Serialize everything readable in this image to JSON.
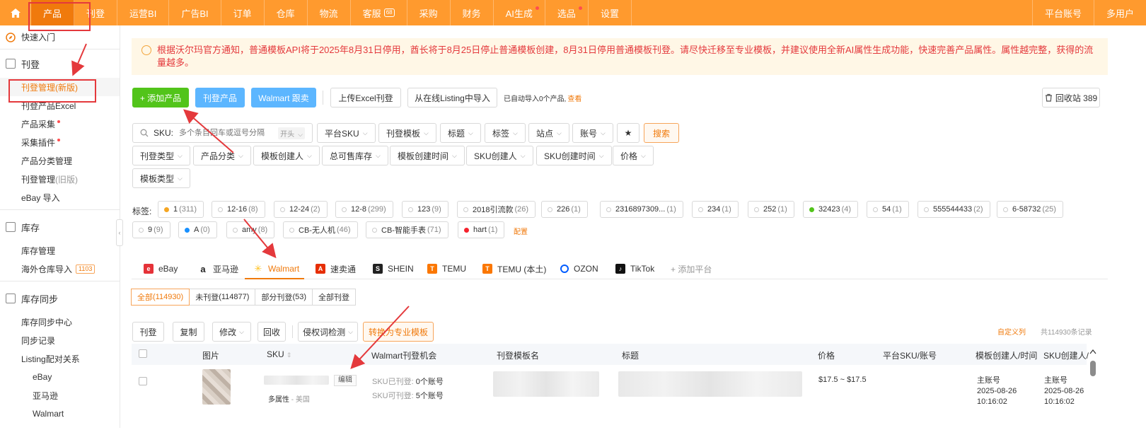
{
  "topnav": {
    "items": [
      {
        "label": "产品",
        "active": true
      },
      {
        "label": "刊登"
      },
      {
        "label": "运营BI"
      },
      {
        "label": "广告BI"
      },
      {
        "label": "订单"
      },
      {
        "label": "仓库"
      },
      {
        "label": "物流"
      },
      {
        "label": "客服",
        "badge": "68"
      },
      {
        "label": "采购"
      },
      {
        "label": "财务"
      },
      {
        "label": "AI生成",
        "dot": true
      },
      {
        "label": "选品",
        "dot": true
      },
      {
        "label": "设置"
      }
    ],
    "right": [
      "平台账号",
      "多用户"
    ]
  },
  "sidebar": {
    "quick": "快速入门",
    "sections": [
      {
        "title": "刊登",
        "items": [
          {
            "label": "刊登管理",
            "suffix": "(新版)",
            "active": true
          },
          {
            "label": "刊登产品Excel"
          },
          {
            "label": "产品采集",
            "dot": true
          },
          {
            "label": "采集插件",
            "dot": true
          },
          {
            "label": "产品分类管理"
          },
          {
            "label": "刊登管理",
            "suffix": "(旧版)"
          },
          {
            "label": "eBay 导入"
          }
        ]
      },
      {
        "title": "库存",
        "items": [
          {
            "label": "库存管理"
          },
          {
            "label": "海外仓库导入",
            "badge": "1103"
          }
        ]
      },
      {
        "title": "库存同步",
        "items": [
          {
            "label": "库存同步中心"
          },
          {
            "label": "同步记录"
          },
          {
            "label": "Listing配对关系"
          },
          {
            "label": "eBay",
            "sub": true
          },
          {
            "label": "亚马逊",
            "sub": true
          },
          {
            "label": "Walmart",
            "sub": true
          }
        ]
      }
    ]
  },
  "notice": {
    "text": "根据沃尔玛官方通知，普通模板API将于2025年8月31日停用，酋长将于8月25日停止普通模板创建，8月31日停用普通模板刊登。请尽快迁移至专业模板，并建议使用全新AI属性生成功能，快速完善产品属性。属性越完整，获得的流量越多。"
  },
  "toolbar": {
    "add": "+ 添加产品",
    "publish": "刊登产品",
    "follow": "Walmart 跟卖",
    "upload": "上传Excel刊登",
    "import": "从在线Listing中导入",
    "import_status": "已自动导入0个产品,",
    "view": "查看",
    "recycle": "回收站 389"
  },
  "filters": {
    "sku_label": "SKU:",
    "sku_placeholder": "多个条目回车或逗号分隔",
    "sku_mode": "开头",
    "row1": [
      "平台SKU",
      "刊登模板",
      "标题",
      "标签",
      "站点",
      "账号"
    ],
    "star": "★",
    "search": "搜索",
    "row2": [
      "刊登类型",
      "产品分类",
      "模板创建人",
      "总可售库存",
      "模板创建时间",
      "SKU创建人",
      "SKU创建时间",
      "价格"
    ],
    "row3": [
      "模板类型"
    ]
  },
  "tags": {
    "label": "标签:",
    "items": [
      {
        "name": "1",
        "count": "(311)",
        "color": "#f5a623"
      },
      {
        "name": "12-16",
        "count": "(8)"
      },
      {
        "name": "12-24",
        "count": "(2)"
      },
      {
        "name": "12-8",
        "count": "(299)"
      },
      {
        "name": "123",
        "count": "(9)"
      },
      {
        "name": "2018引流款",
        "count": "(26)"
      },
      {
        "name": "226",
        "count": "(1)"
      },
      {
        "name": "2316897309...",
        "count": "(1)"
      },
      {
        "name": "234",
        "count": "(1)"
      },
      {
        "name": "252",
        "count": "(1)"
      },
      {
        "name": "32423",
        "count": "(4)",
        "color": "#52c41a"
      },
      {
        "name": "54",
        "count": "(1)"
      },
      {
        "name": "555544433",
        "count": "(2)"
      },
      {
        "name": "6-58732",
        "count": "(25)"
      },
      {
        "name": "9",
        "count": "(9)"
      },
      {
        "name": "A",
        "count": "(0)",
        "color": "#1890ff"
      },
      {
        "name": "amy",
        "count": "(8)"
      },
      {
        "name": "CB-无人机",
        "count": "(46)"
      },
      {
        "name": "CB-智能手表",
        "count": "(71)"
      },
      {
        "name": "hart",
        "count": "(1)",
        "color": "#f5222d"
      }
    ],
    "config": "配置"
  },
  "platforms": [
    {
      "name": "eBay",
      "icon": "ebay-icon",
      "color": "#e53238"
    },
    {
      "name": "亚马逊",
      "icon": "amazon-icon",
      "color": "#222"
    },
    {
      "name": "Walmart",
      "icon": "walmart-icon",
      "color": "#ffc220",
      "active": true
    },
    {
      "name": "速卖通",
      "icon": "aliexpress-icon",
      "color": "#e62e04"
    },
    {
      "name": "SHEIN",
      "icon": "shein-icon",
      "color": "#222"
    },
    {
      "name": "TEMU",
      "icon": "temu-icon",
      "color": "#fb7701"
    },
    {
      "name": "TEMU (本土)",
      "icon": "temu-local-icon",
      "color": "#fb7701"
    },
    {
      "name": "OZON",
      "icon": "ozon-icon",
      "color": "#005bff"
    },
    {
      "name": "TikTok",
      "icon": "tiktok-icon",
      "color": "#111"
    },
    {
      "name": "+ 添加平台",
      "icon": "",
      "color": ""
    }
  ],
  "status_tabs": [
    {
      "label": "全部",
      "count": "(114930)",
      "active": true
    },
    {
      "label": "未刊登",
      "count": "(114877)"
    },
    {
      "label": "部分刊登",
      "count": "(53)"
    },
    {
      "label": "全部刊登",
      "count": ""
    }
  ],
  "actions": {
    "publish": "刊登",
    "copy": "复制",
    "modify": "修改",
    "recycle": "回收",
    "ip_check": "侵权词检测",
    "convert": "转换为专业模板",
    "custom_cols": "自定义列",
    "total": "共114930条记录"
  },
  "table": {
    "headers": [
      "图片",
      "SKU",
      "Walmart刊登机会",
      "刊登模板名",
      "标题",
      "价格",
      "平台SKU/账号",
      "模板创建人/时间",
      "SKU创建人/"
    ],
    "rows": [
      {
        "edit": "编辑",
        "attr": "多属性",
        "site": "美国",
        "published_label": "SKU已刊登:",
        "published_count": "0个账号",
        "available_label": "SKU可刊登:",
        "available_count": "5个账号",
        "price": "$17.5 ~ $17.5",
        "tpl_creator": "主账号",
        "tpl_date": "2025-08-26",
        "tpl_time": "10:16:02",
        "sku_creator": "主账号",
        "sku_date": "2025-08-26",
        "sku_time": "10:16:02"
      }
    ]
  }
}
